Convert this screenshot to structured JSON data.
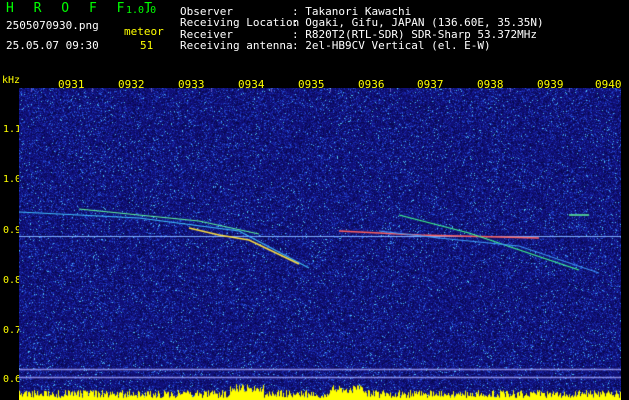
{
  "app": {
    "title": "H R O F F T",
    "version": "1.0.0"
  },
  "file": {
    "name": "2505070930.png",
    "datetime": "25.05.07 09:30"
  },
  "meteor": {
    "label": "meteor",
    "count": "51"
  },
  "info": [
    {
      "label": "Observer",
      "value": ": Takanori Kawachi"
    },
    {
      "label": "Receiving Location",
      "value": ": Ogaki, Gifu, JAPAN (136.60E, 35.35N)"
    },
    {
      "label": "Receiver",
      "value": ": R820T2(RTL-SDR) SDR-Sharp 53.372MHz"
    },
    {
      "label": "Receiving antenna",
      "value": ": 2el-HB9CV Vertical (el. E-W)"
    }
  ],
  "time_axis": [
    "0931",
    "0932",
    "0933",
    "0934",
    "0935",
    "0936",
    "0937",
    "0938",
    "0939",
    "0940"
  ],
  "freq_axis": {
    "unit": "kHz",
    "labels": [
      "1.1",
      "1.0",
      "0.9",
      "0.8",
      "0.7",
      "0.6"
    ]
  },
  "colors": {
    "header_green": "#00ff00",
    "axis_yellow": "#ffff00",
    "background": "#00008b",
    "baseline": "#7fb0ff"
  }
}
